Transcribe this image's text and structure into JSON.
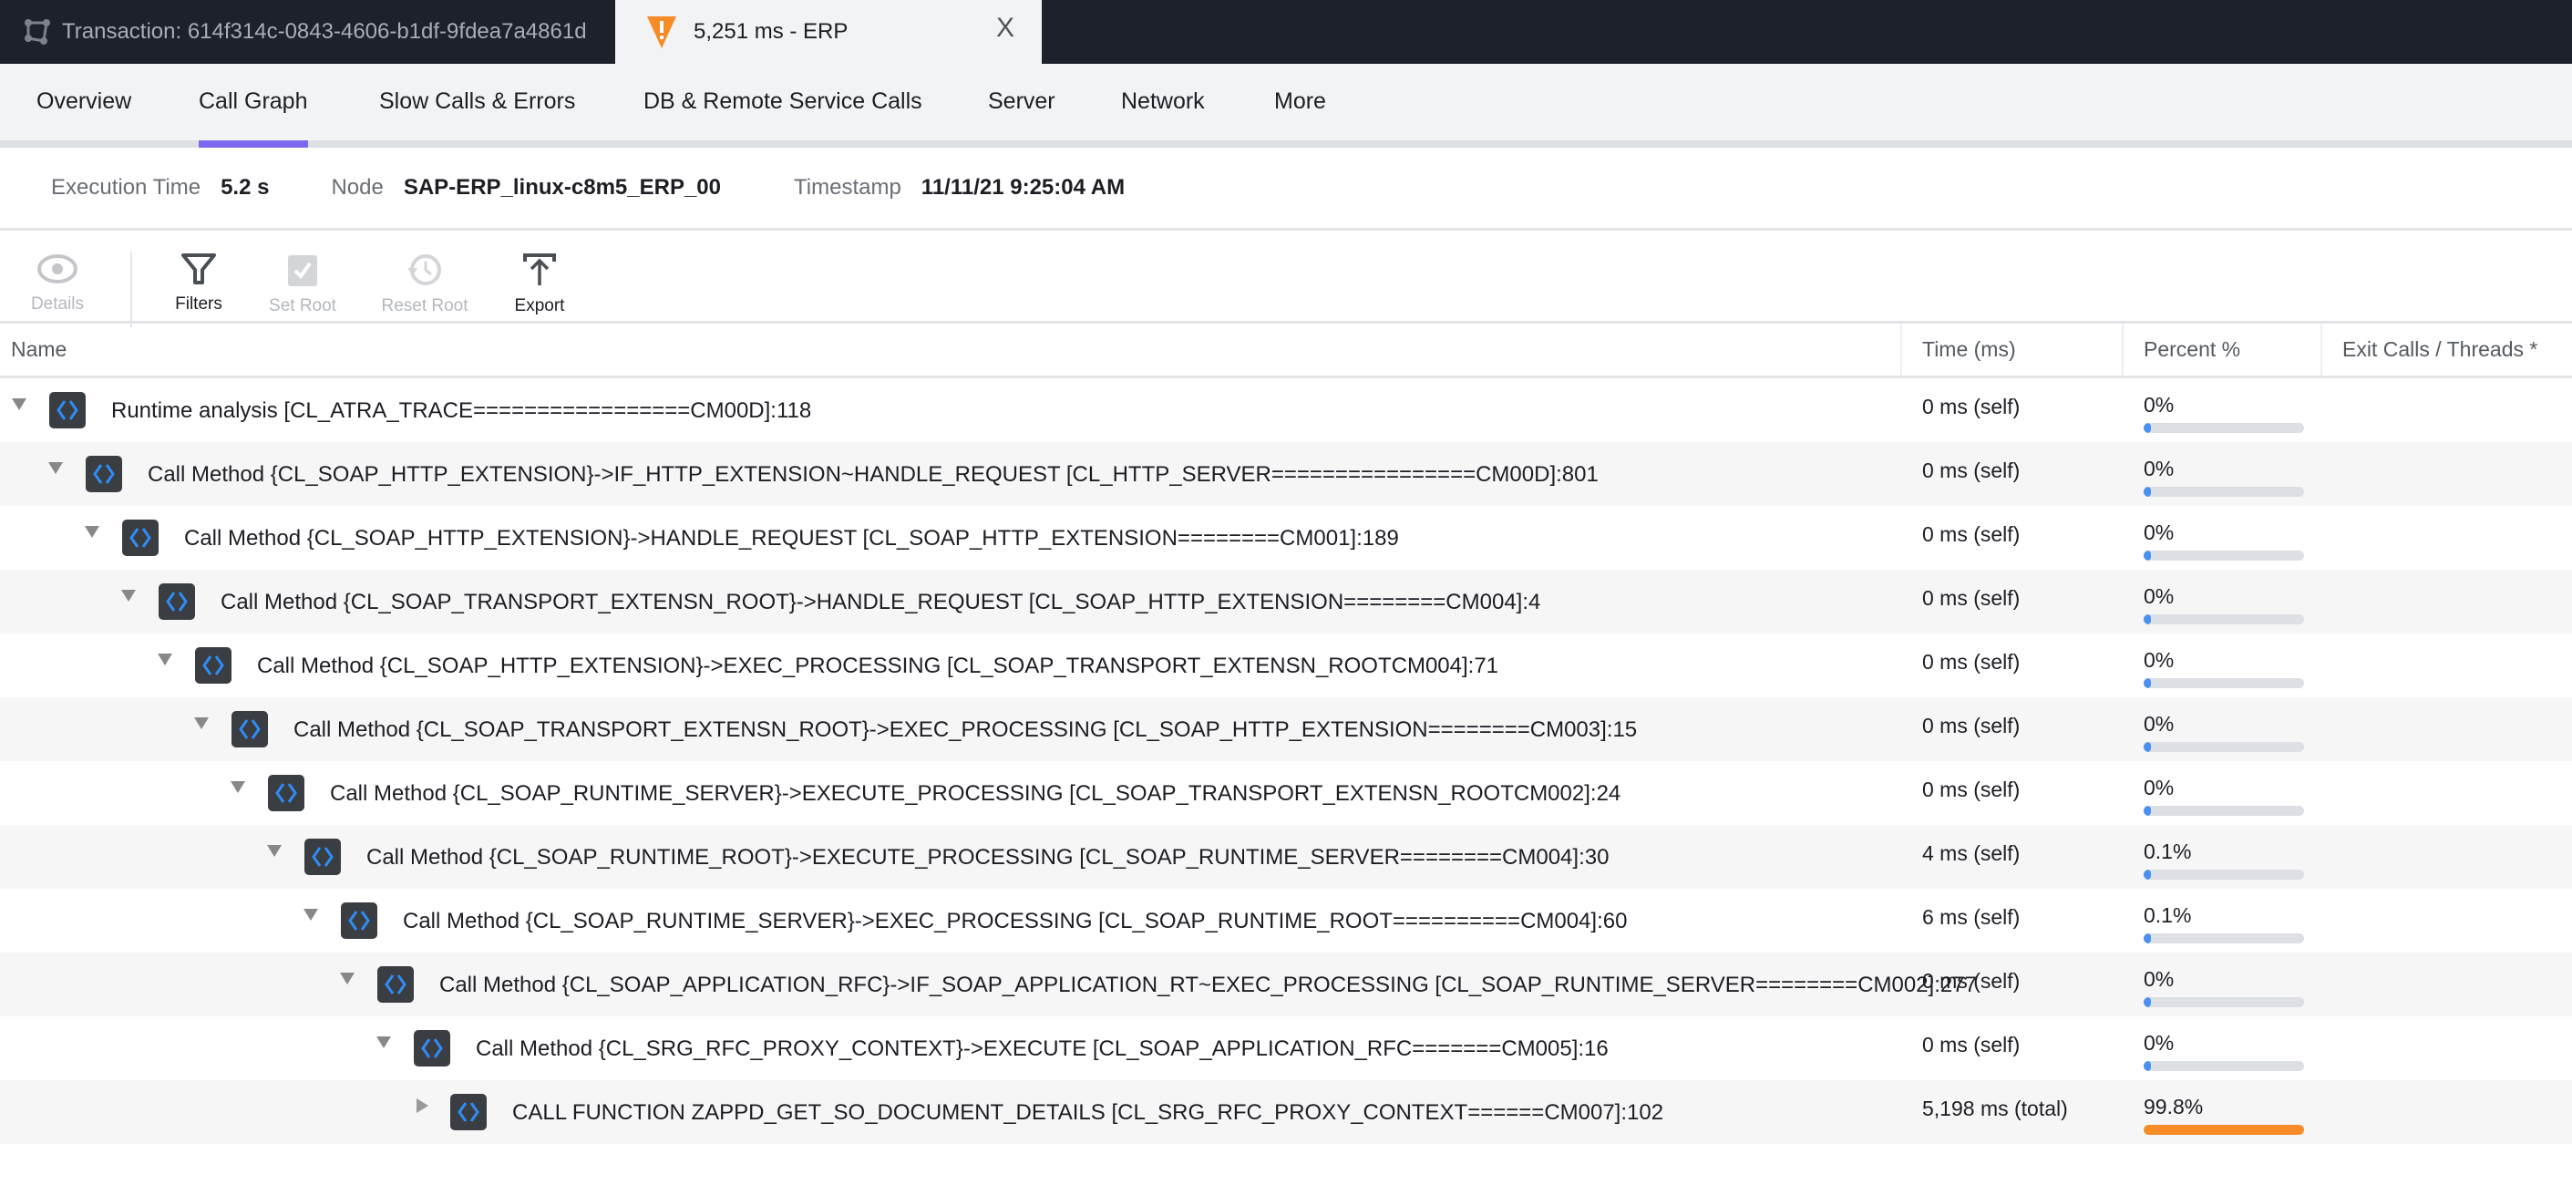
{
  "tabs": {
    "transaction": "Transaction: 614f314c-0843-4606-b1df-9fdea7a4861d",
    "active": "5,251 ms - ERP",
    "close": "X"
  },
  "nav": [
    "Overview",
    "Call Graph",
    "Slow Calls & Errors",
    "DB & Remote Service Calls",
    "Server",
    "Network",
    "More"
  ],
  "nav_active": "Call Graph",
  "info": {
    "exec_label": "Execution Time",
    "exec_value": "5.2 s",
    "node_label": "Node",
    "node_value": "SAP-ERP_linux-c8m5_ERP_00",
    "ts_label": "Timestamp",
    "ts_value": "11/11/21 9:25:04 AM"
  },
  "toolbar": {
    "details": "Details",
    "filters": "Filters",
    "set_root": "Set Root",
    "reset_root": "Reset Root",
    "export": "Export"
  },
  "columns": {
    "name": "Name",
    "time": "Time (ms)",
    "percent": "Percent %",
    "exit": "Exit Calls / Threads *"
  },
  "colors": {
    "accent": "#7b68ee",
    "bar_blue": "#4a90f0",
    "bar_orange": "#f68b27",
    "warning": "#f68b27"
  },
  "rows": [
    {
      "name": "Runtime analysis [CL_ATRA_TRACE=================CM00D]:118",
      "time": "0 ms (self)",
      "percent": "0%",
      "pct": 0,
      "expanded": true
    },
    {
      "name": "Call Method {CL_SOAP_HTTP_EXTENSION}->IF_HTTP_EXTENSION~HANDLE_REQUEST [CL_HTTP_SERVER================CM00D]:801",
      "time": "0 ms (self)",
      "percent": "0%",
      "pct": 0,
      "expanded": true
    },
    {
      "name": "Call Method {CL_SOAP_HTTP_EXTENSION}->HANDLE_REQUEST [CL_SOAP_HTTP_EXTENSION========CM001]:189",
      "time": "0 ms (self)",
      "percent": "0%",
      "pct": 0,
      "expanded": true
    },
    {
      "name": "Call Method {CL_SOAP_TRANSPORT_EXTENSN_ROOT}->HANDLE_REQUEST [CL_SOAP_HTTP_EXTENSION========CM004]:4",
      "time": "0 ms (self)",
      "percent": "0%",
      "pct": 0,
      "expanded": true
    },
    {
      "name": "Call Method {CL_SOAP_HTTP_EXTENSION}->EXEC_PROCESSING [CL_SOAP_TRANSPORT_EXTENSN_ROOTCM004]:71",
      "time": "0 ms (self)",
      "percent": "0%",
      "pct": 0,
      "expanded": true
    },
    {
      "name": "Call Method {CL_SOAP_TRANSPORT_EXTENSN_ROOT}->EXEC_PROCESSING [CL_SOAP_HTTP_EXTENSION========CM003]:15",
      "time": "0 ms (self)",
      "percent": "0%",
      "pct": 0,
      "expanded": true
    },
    {
      "name": "Call Method {CL_SOAP_RUNTIME_SERVER}->EXECUTE_PROCESSING [CL_SOAP_TRANSPORT_EXTENSN_ROOTCM002]:24",
      "time": "0 ms (self)",
      "percent": "0%",
      "pct": 0,
      "expanded": true
    },
    {
      "name": "Call Method {CL_SOAP_RUNTIME_ROOT}->EXECUTE_PROCESSING [CL_SOAP_RUNTIME_SERVER========CM004]:30",
      "time": "4 ms (self)",
      "percent": "0.1%",
      "pct": 0.1,
      "expanded": true
    },
    {
      "name": "Call Method {CL_SOAP_RUNTIME_SERVER}->EXEC_PROCESSING [CL_SOAP_RUNTIME_ROOT==========CM004]:60",
      "time": "6 ms (self)",
      "percent": "0.1%",
      "pct": 0.1,
      "expanded": true
    },
    {
      "name": "Call Method {CL_SOAP_APPLICATION_RFC}->IF_SOAP_APPLICATION_RT~EXEC_PROCESSING [CL_SOAP_RUNTIME_SERVER========CM002]:277",
      "time": "0 ms (self)",
      "percent": "0%",
      "pct": 0,
      "expanded": true
    },
    {
      "name": "Call Method {CL_SRG_RFC_PROXY_CONTEXT}->EXECUTE [CL_SOAP_APPLICATION_RFC=======CM005]:16",
      "time": "0 ms (self)",
      "percent": "0%",
      "pct": 0,
      "expanded": true
    },
    {
      "name": "CALL FUNCTION ZAPPD_GET_SO_DOCUMENT_DETAILS [CL_SRG_RFC_PROXY_CONTEXT======CM007]:102",
      "time": "5,198 ms (total)",
      "percent": "99.8%",
      "pct": 99.8,
      "expanded": false
    }
  ]
}
